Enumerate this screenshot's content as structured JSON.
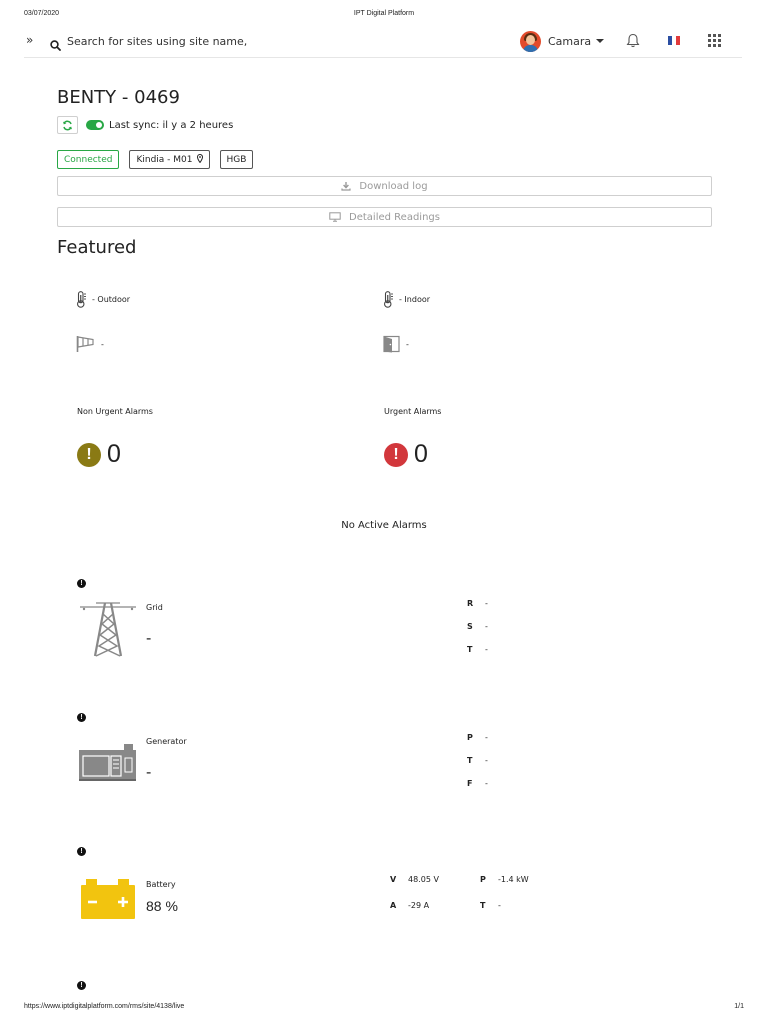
{
  "print_header": {
    "date": "03/07/2020",
    "title": "IPT Digital Platform"
  },
  "topbar": {
    "expand_icon": "chevrons-right-icon",
    "search": {
      "icon": "search-icon",
      "placeholder": "Search for sites using site name, ar",
      "value": ""
    },
    "user": {
      "name": "Camara",
      "avatar": "avatar"
    },
    "notifications_icon": "bell-icon",
    "language_flag": "france-flag-icon",
    "apps_icon": "grid-apps-icon"
  },
  "site": {
    "title": "BENTY - 0469",
    "sync_text": "Last sync: il y a 2 heures",
    "tags": {
      "status": "Connected",
      "location": "Kindia - M01",
      "code": "HGB"
    },
    "download_log_label": "Download log",
    "detailed_readings_label": "Detailed Readings"
  },
  "featured": {
    "title": "Featured",
    "outdoor_label": "- Outdoor",
    "indoor_label": "- Indoor",
    "wind_value": "-",
    "door_value": "-",
    "non_urgent_label": "Non Urgent Alarms",
    "non_urgent_count": "0",
    "urgent_label": "Urgent Alarms",
    "urgent_count": "0",
    "no_alarms_text": "No Active Alarms"
  },
  "grid": {
    "label": "Grid",
    "value": "-",
    "readings": [
      {
        "key": "R",
        "value": "-"
      },
      {
        "key": "S",
        "value": "-"
      },
      {
        "key": "T",
        "value": "-"
      }
    ]
  },
  "generator": {
    "label": "Generator",
    "value": "-",
    "readings": [
      {
        "key": "P",
        "value": "-"
      },
      {
        "key": "T",
        "value": "-"
      },
      {
        "key": "F",
        "value": "-"
      }
    ]
  },
  "battery": {
    "label": "Battery",
    "value": "88 %",
    "readings": [
      {
        "key": "V",
        "value": "48.05 V"
      },
      {
        "key": "A",
        "value": "-29 A"
      },
      {
        "key": "P",
        "value": "-1.4 kW"
      },
      {
        "key": "T",
        "value": "-"
      }
    ]
  },
  "footer": {
    "url": "https://www.iptdigitalplatform.com/rms/site/4138/live",
    "page": "1/1"
  },
  "colors": {
    "connected": "#28a745",
    "non_urgent": "#8a7a14",
    "urgent": "#d2373c",
    "battery": "#f2c40f",
    "icon_gray": "#7a7a7a"
  }
}
